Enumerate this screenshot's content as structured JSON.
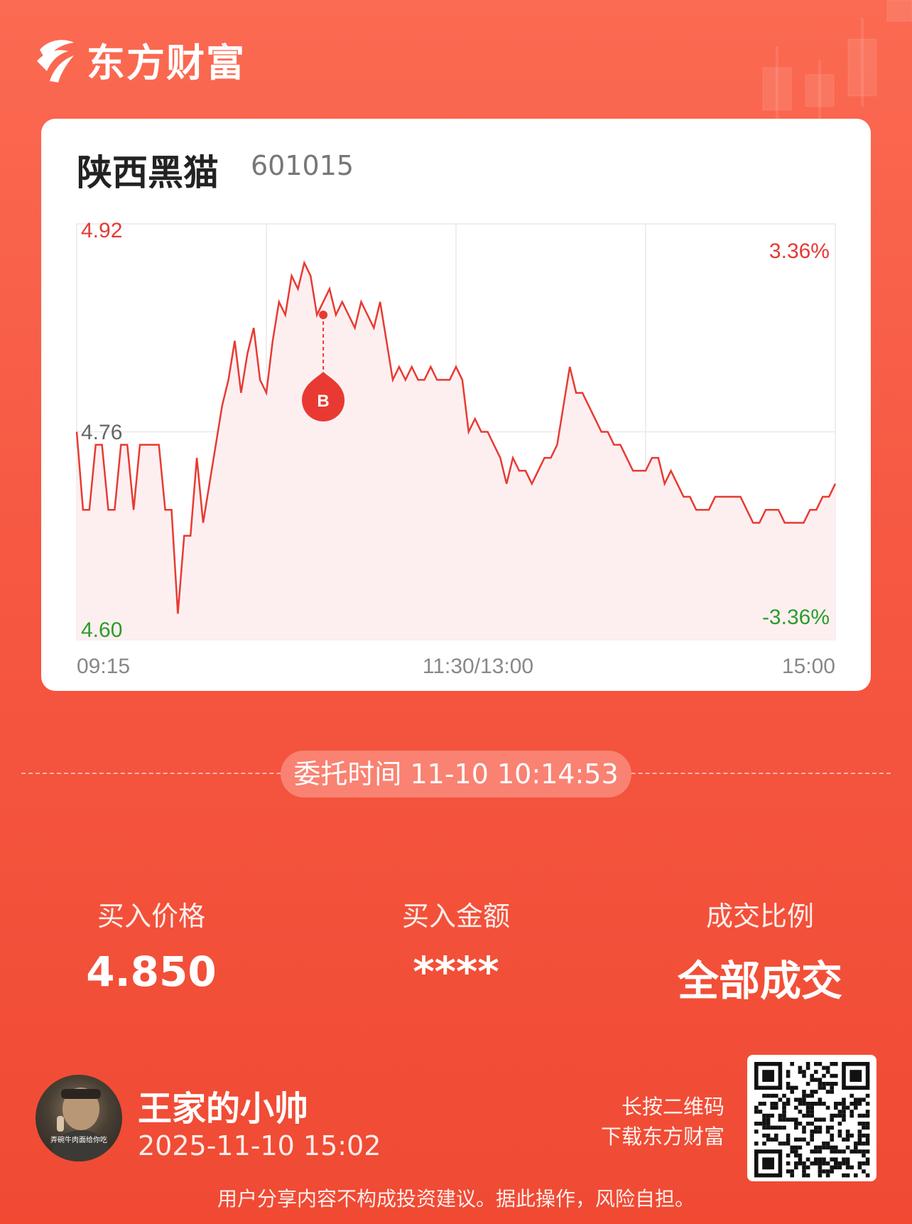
{
  "brand": {
    "name": "东方财富"
  },
  "stock": {
    "name": "陕西黑猫",
    "code": "601015"
  },
  "chart_data": {
    "type": "line",
    "y_labels": {
      "high": "4.92",
      "mid": "4.76",
      "low": "4.60"
    },
    "pct_labels": {
      "up": "3.36%",
      "down": "-3.36%"
    },
    "x_labels": {
      "start": "09:15",
      "mid": "11:30/13:00",
      "end": "15:00"
    },
    "ylim": [
      4.6,
      4.92
    ],
    "buy_marker": {
      "label": "B",
      "index": 39,
      "value": 4.85
    },
    "values": [
      4.76,
      4.7,
      4.7,
      4.75,
      4.75,
      4.7,
      4.7,
      4.75,
      4.75,
      4.7,
      4.75,
      4.75,
      4.75,
      4.75,
      4.7,
      4.7,
      4.62,
      4.68,
      4.68,
      4.74,
      4.69,
      4.72,
      4.75,
      4.78,
      4.8,
      4.83,
      4.79,
      4.82,
      4.84,
      4.8,
      4.79,
      4.83,
      4.86,
      4.85,
      4.88,
      4.87,
      4.89,
      4.88,
      4.85,
      4.86,
      4.87,
      4.85,
      4.86,
      4.85,
      4.84,
      4.86,
      4.85,
      4.84,
      4.86,
      4.83,
      4.8,
      4.81,
      4.8,
      4.81,
      4.8,
      4.8,
      4.81,
      4.8,
      4.8,
      4.8,
      4.81,
      4.8,
      4.76,
      4.77,
      4.76,
      4.76,
      4.75,
      4.74,
      4.72,
      4.74,
      4.73,
      4.73,
      4.72,
      4.73,
      4.74,
      4.74,
      4.75,
      4.78,
      4.81,
      4.79,
      4.79,
      4.78,
      4.77,
      4.76,
      4.76,
      4.75,
      4.75,
      4.74,
      4.73,
      4.73,
      4.73,
      4.74,
      4.74,
      4.72,
      4.73,
      4.72,
      4.71,
      4.71,
      4.7,
      4.7,
      4.7,
      4.71,
      4.71,
      4.71,
      4.71,
      4.71,
      4.7,
      4.69,
      4.69,
      4.7,
      4.7,
      4.7,
      4.69,
      4.69,
      4.69,
      4.69,
      4.7,
      4.7,
      4.71,
      4.71,
      4.72
    ],
    "colors": {
      "line": "#e83a32",
      "fill": "#fdeff0",
      "up": "#e53935",
      "down": "#2a9d2a",
      "neutral": "#666666",
      "grid": "#e9e9e9"
    }
  },
  "order": {
    "label": "委托时间",
    "time": "11-10 10:14:53"
  },
  "stats": [
    {
      "label": "买入价格",
      "value": "4.850"
    },
    {
      "label": "买入金额",
      "value": "****"
    },
    {
      "label": "成交比例",
      "value": "全部成交"
    }
  ],
  "user": {
    "name": "王家的小帅",
    "share_time": "2025-11-10 15:02",
    "avatar_caption": "弄碗牛肉面给你吃"
  },
  "qr": {
    "hint_line1": "长按二维码",
    "hint_line2": "下载东方财富"
  },
  "disclaimer": "用户分享内容不构成投资建议。据此操作，风险自担。"
}
